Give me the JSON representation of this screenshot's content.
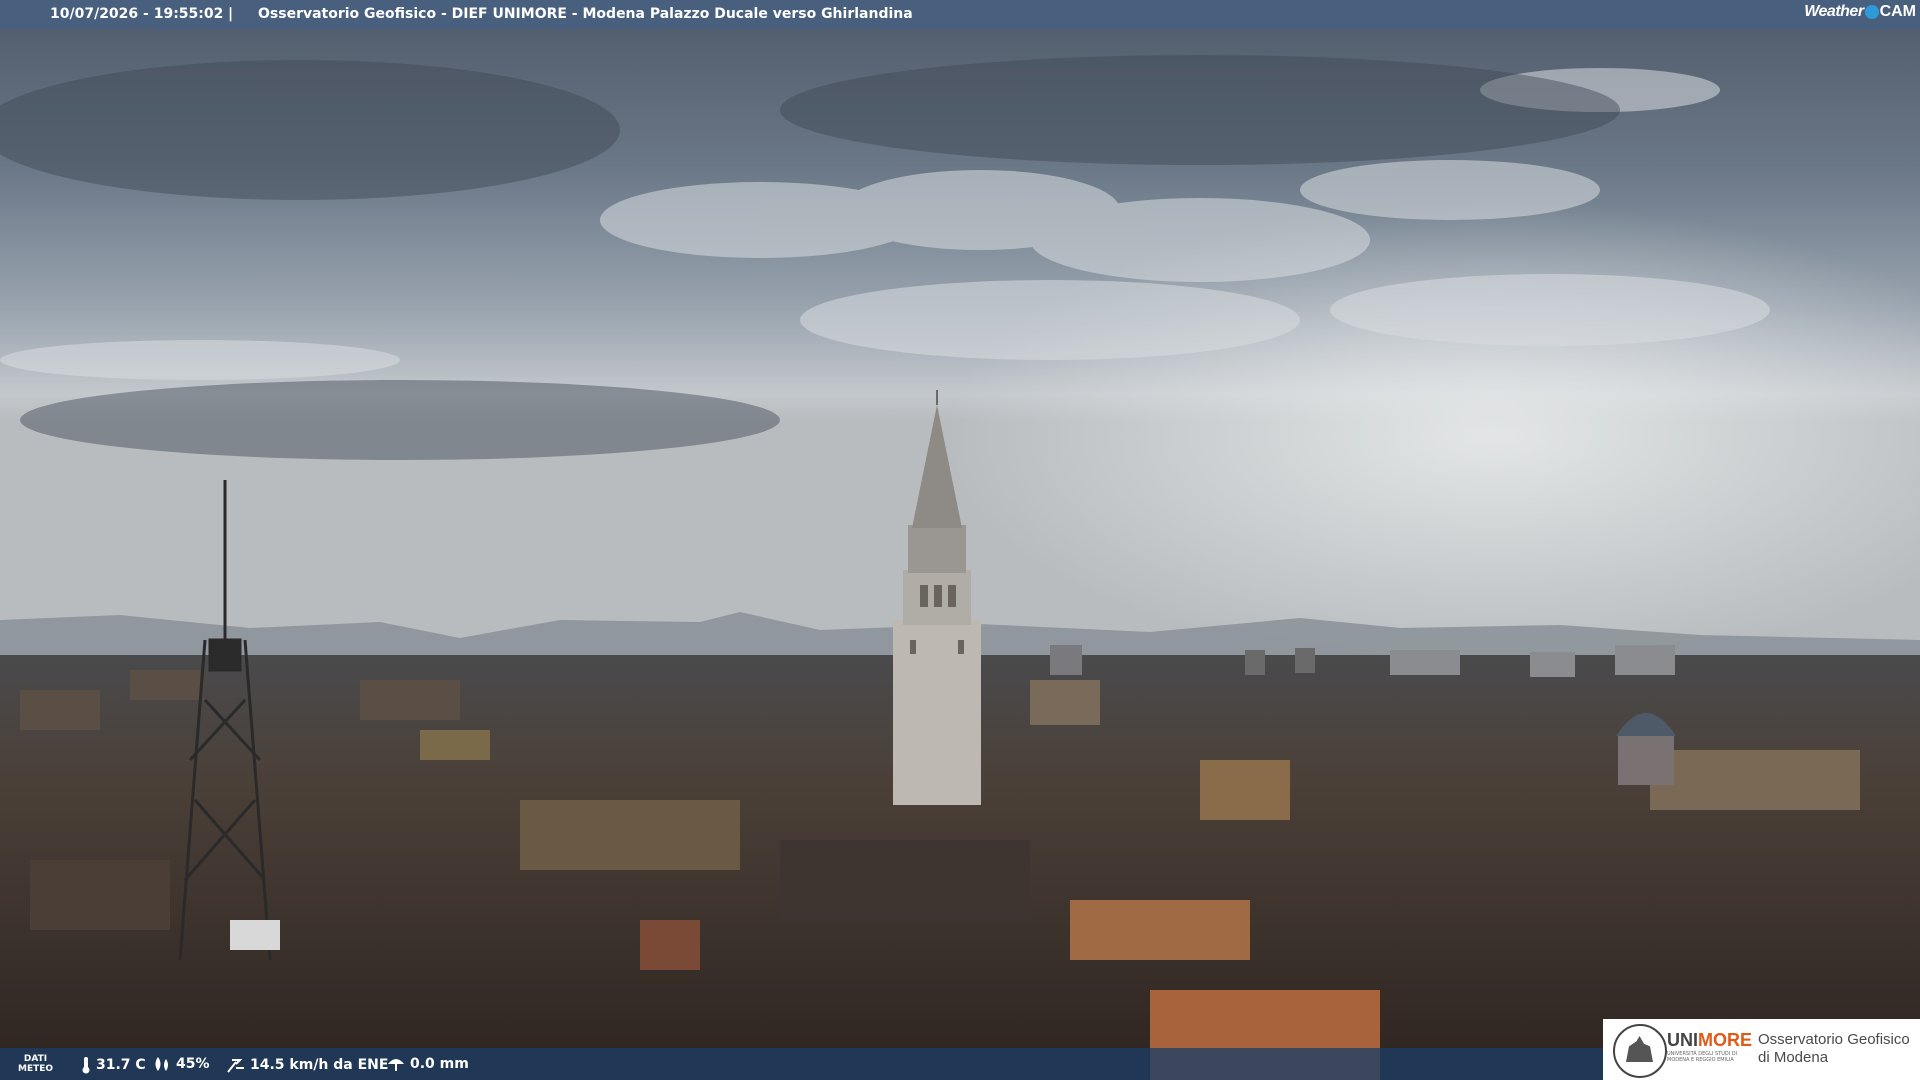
{
  "header": {
    "timestamp": "10/07/2026 - 19:55:02",
    "separator": "|",
    "title": "Osservatorio Geofisico - DIEF UNIMORE - Modena Palazzo Ducale verso Ghirlandina"
  },
  "brand": {
    "part1": "Weather",
    "part2": "CAM"
  },
  "weather": {
    "label_line1": "DATI",
    "label_line2": "METEO",
    "temperature": "31.7 C",
    "humidity": "45%",
    "wind": "14.5 km/h da ENE",
    "rain": "0.0 mm"
  },
  "logo": {
    "uni_part1": "UNI",
    "uni_part2": "MORE",
    "uni_sub": "UNIVERSITÀ DEGLI STUDI DI MODENA E REGGIO EMILIA",
    "obs_line1": "Osservatorio Geofisico",
    "obs_line2": "di Modena"
  },
  "colors": {
    "bar": "#486080",
    "accent": "#e05a18",
    "brand_dot": "#2f9ad8"
  },
  "icons": [
    "thermometer-icon",
    "humidity-drop-icon",
    "wind-icon",
    "rain-gauge-icon"
  ]
}
